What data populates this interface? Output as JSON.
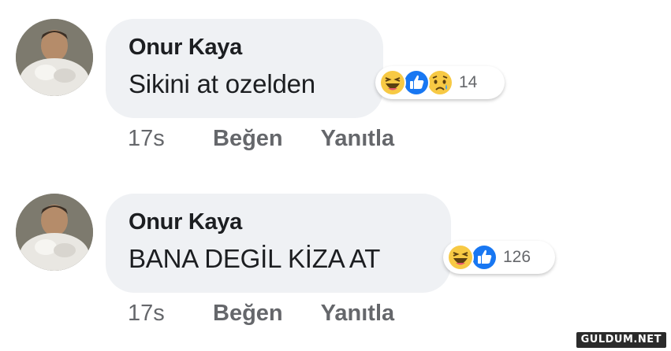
{
  "comments": [
    {
      "author": "Onur Kaya",
      "text": "Sikini at ozelden",
      "reactions": [
        "haha-icon",
        "like-icon",
        "sad-icon"
      ],
      "reaction_count": "14",
      "time": "17s",
      "like_label": "Beğen",
      "reply_label": "Yanıtla"
    },
    {
      "author": "Onur Kaya",
      "text": "BANA DEGİL KİZA AT",
      "reactions": [
        "haha-icon",
        "like-icon"
      ],
      "reaction_count": "126",
      "time": "17s",
      "like_label": "Beğen",
      "reply_label": "Yanıtla"
    }
  ],
  "watermark": "GULDUM.NET",
  "colors": {
    "bubble": "#eff1f4",
    "secondary_text": "#65676b",
    "like_blue": "#1877f2",
    "reaction_yellow": "#f7c944"
  }
}
